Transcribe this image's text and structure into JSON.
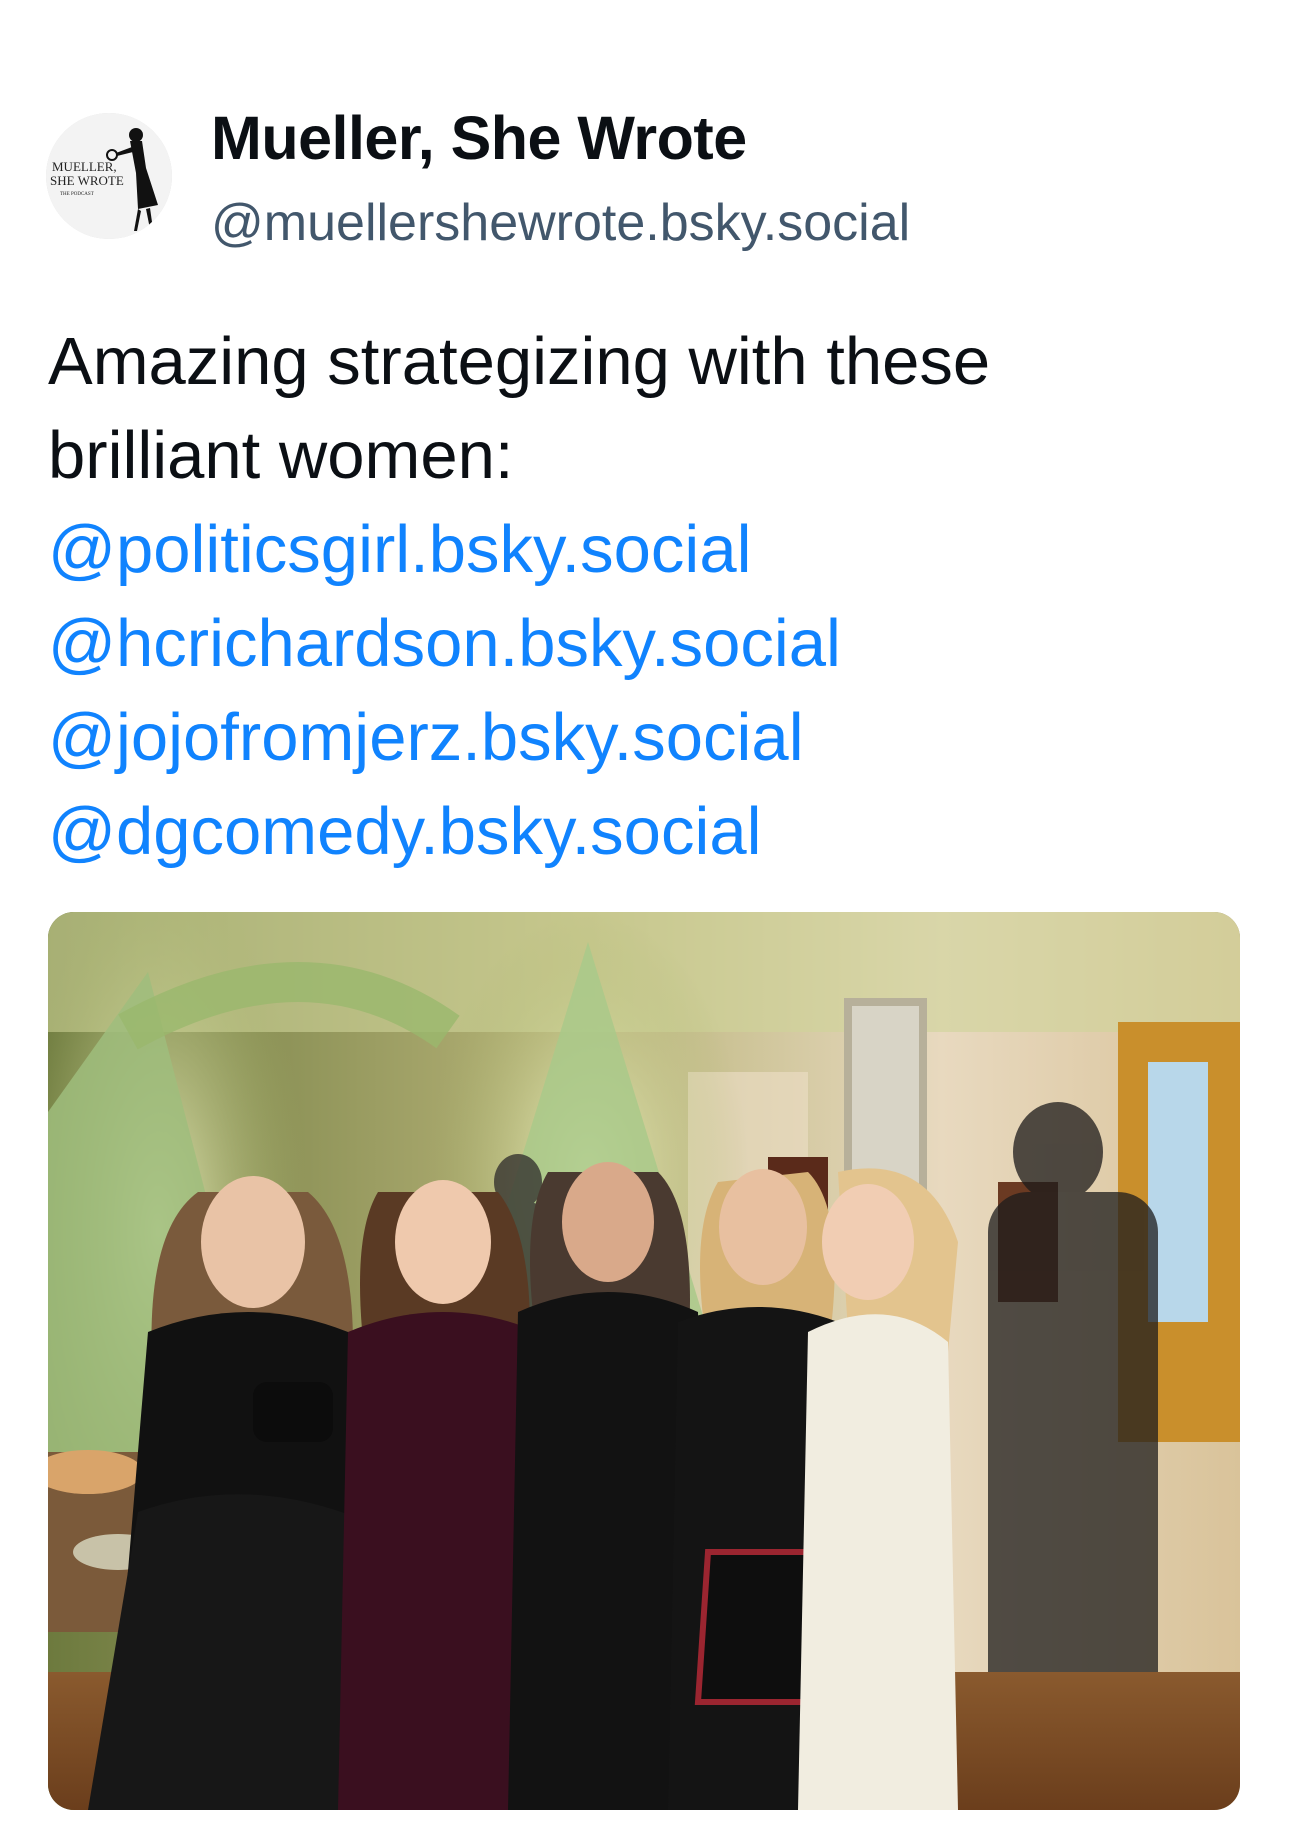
{
  "post": {
    "author": {
      "display_name": "Mueller, She Wrote",
      "handle": "@muellershewrote.bsky.social",
      "avatar_logo_text": [
        "MUELLER,",
        "SHE WROTE",
        "THE PODCAST"
      ]
    },
    "text_lines": [
      "Amazing strategizing with these",
      "brilliant women:"
    ],
    "mentions": [
      "@politicsgirl.bsky.social",
      "@hcrichardson.bsky.social",
      "@jojofromjerz.bsky.social",
      "@dgcomedy.bsky.social"
    ],
    "image": {
      "icon": "photo-image"
    }
  },
  "colors": {
    "text": "#0b0f14",
    "handle": "#42576c",
    "mention": "#1083fe",
    "background": "#ffffff"
  }
}
